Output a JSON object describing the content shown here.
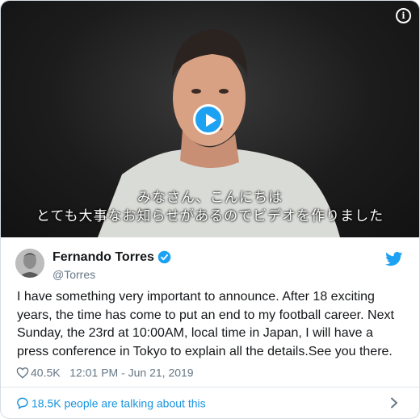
{
  "video": {
    "subtitle_line1": "みなさん、こんにちは",
    "subtitle_line2": "とても大事なお知らせがあるのでビデオを作りました",
    "info_icon": "info-icon",
    "play_icon": "play-icon"
  },
  "author": {
    "name": "Fernando Torres",
    "handle": "@Torres",
    "verified_icon": "verified-badge-icon",
    "avatar_icon": "avatar"
  },
  "tweet": {
    "text": "I have something very important to announce. After 18 exciting years, the time has come to put an end to my football career. Next Sunday, the 23rd at 10:00AM, local time in Japan, I will have a press conference in Tokyo to explain all the details.See you there.",
    "likes": "40.5K",
    "timestamp": "12:01 PM - Jun 21, 2019"
  },
  "footer": {
    "talking_label": "18.5K people are talking about this"
  },
  "colors": {
    "twitter_blue": "#1da1f2",
    "link_blue": "#1b95e0",
    "secondary_text": "#657786",
    "primary_text": "#14171a",
    "border": "#e1e8ed"
  }
}
